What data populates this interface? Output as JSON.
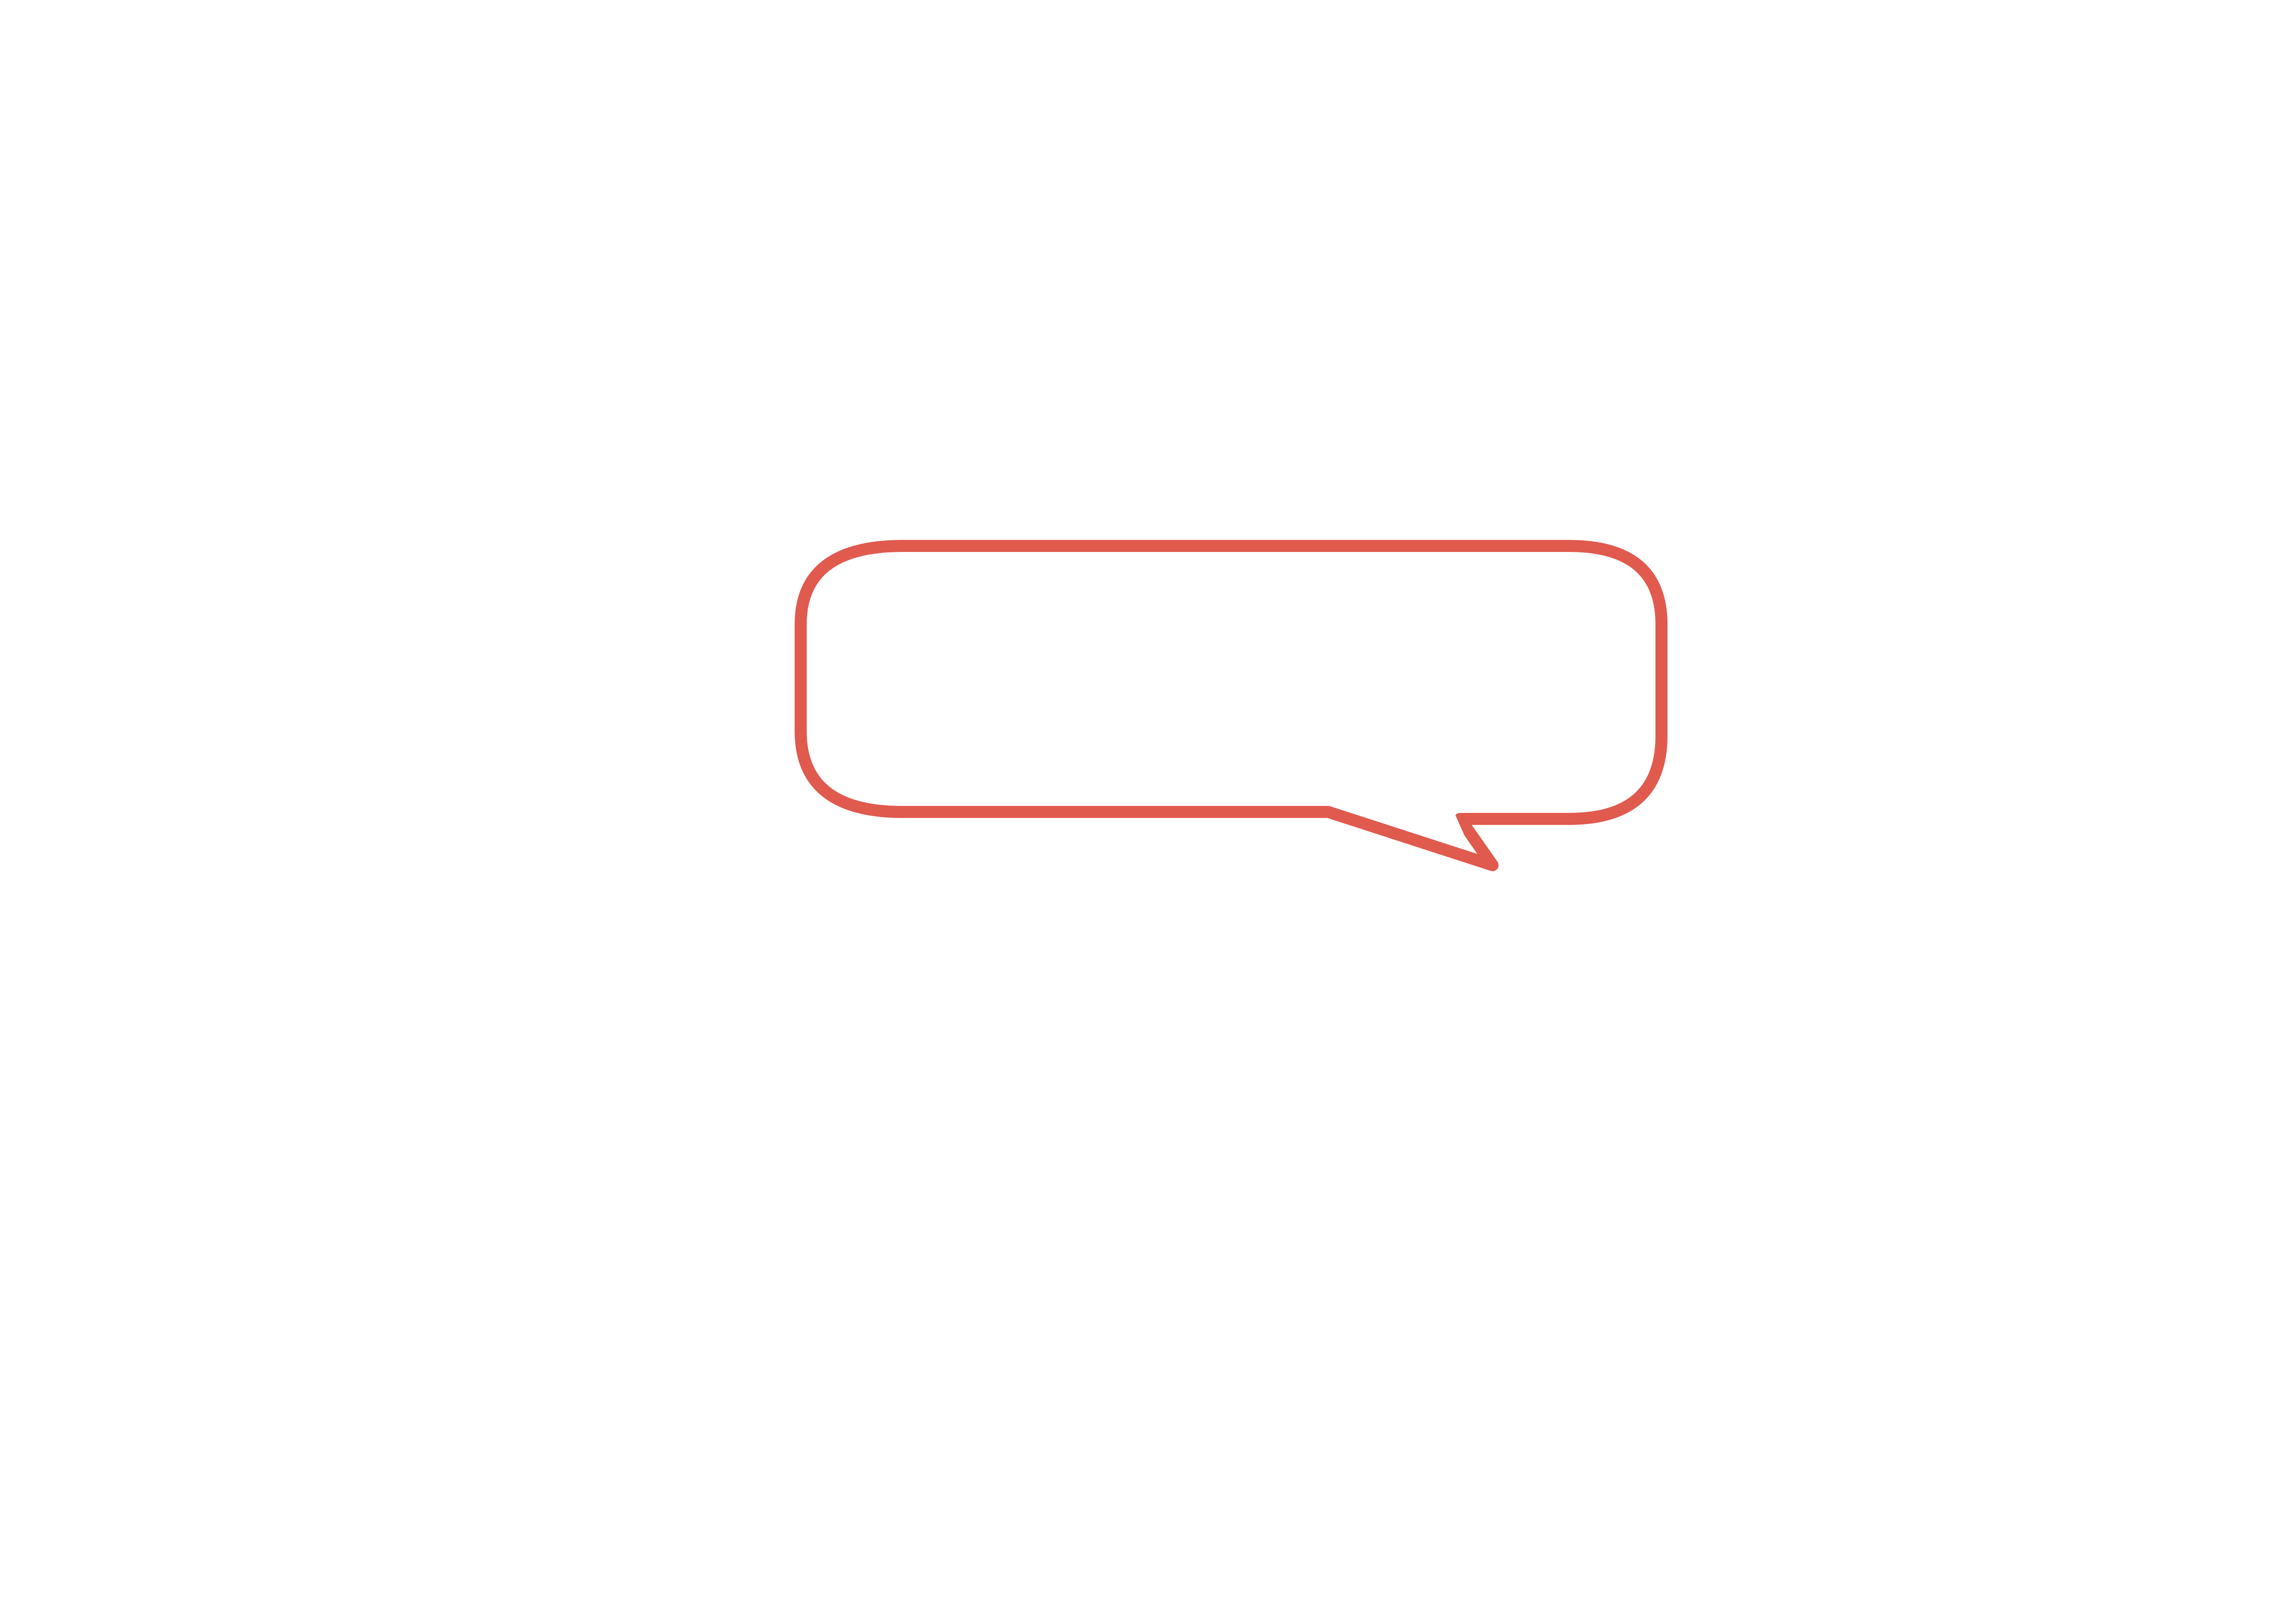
{
  "speech_bubble": {
    "text": "",
    "stroke_color": "#E05A4E",
    "fill_color": "#FFFFFF",
    "icon": "speech-bubble-icon"
  },
  "page": {
    "background_color": "#FFFFFF"
  }
}
